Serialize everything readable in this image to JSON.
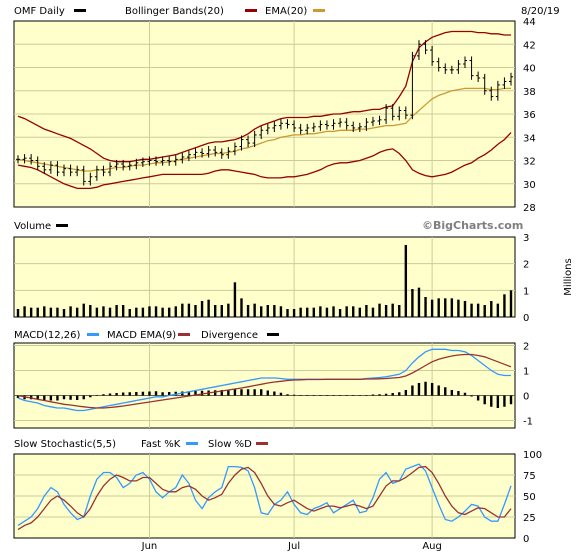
{
  "chart_data": {
    "type": "stock",
    "ticker_label": "OMF Daily",
    "date_label": "8/20/19",
    "watermark": "©BigCharts.com",
    "x_labels": [
      "Jun",
      "Jul",
      "Aug"
    ],
    "colors": {
      "bg": "#ffffcc",
      "grid": "#cccc99",
      "price": "#000000",
      "bollinger": "#990000",
      "ema": "#cc9933",
      "macd": "#3399ff",
      "macd_ema": "#993333",
      "fast_k": "#3399ff",
      "slow_d": "#993333"
    },
    "price_panel": {
      "legend": [
        "OMF Daily",
        "Bollinger Bands(20)",
        "EMA(20)"
      ],
      "ylim": [
        28,
        44
      ],
      "yticks": [
        28,
        30,
        32,
        34,
        36,
        38,
        40,
        42,
        44
      ],
      "close": [
        32.1,
        32.2,
        32.0,
        31.5,
        31.2,
        31.6,
        31.0,
        31.3,
        31.0,
        31.2,
        30.2,
        30.6,
        31.2,
        31.0,
        31.5,
        31.7,
        31.5,
        31.6,
        31.8,
        31.9,
        32.0,
        31.9,
        32.0,
        31.9,
        32.1,
        32.3,
        32.5,
        32.7,
        32.6,
        32.9,
        32.7,
        32.5,
        32.8,
        33.2,
        33.8,
        33.5,
        34.2,
        34.6,
        34.8,
        35.0,
        35.2,
        35.1,
        34.8,
        34.6,
        34.8,
        34.9,
        35.1,
        35.0,
        35.2,
        35.3,
        35.0,
        34.8,
        34.9,
        35.3,
        35.4,
        35.5,
        36.5,
        35.8,
        36.3,
        35.9,
        41.0,
        42.0,
        41.5,
        40.5,
        40.0,
        39.8,
        39.8,
        40.3,
        40.6,
        39.3,
        39.1,
        38.0,
        37.5,
        38.5,
        38.8,
        39.2
      ],
      "ema": [
        32.1,
        32.0,
        31.9,
        31.8,
        31.7,
        31.6,
        31.5,
        31.4,
        31.3,
        31.2,
        31.1,
        31.1,
        31.2,
        31.2,
        31.3,
        31.4,
        31.4,
        31.5,
        31.6,
        31.6,
        31.7,
        31.8,
        31.8,
        31.9,
        32.0,
        32.1,
        32.2,
        32.3,
        32.4,
        32.5,
        32.6,
        32.6,
        32.7,
        32.8,
        33.0,
        33.1,
        33.3,
        33.5,
        33.7,
        33.8,
        34.0,
        34.1,
        34.2,
        34.2,
        34.3,
        34.3,
        34.4,
        34.5,
        34.5,
        34.6,
        34.6,
        34.6,
        34.7,
        34.7,
        34.8,
        34.9,
        35.0,
        35.0,
        35.1,
        35.2,
        35.8,
        36.3,
        36.8,
        37.3,
        37.6,
        37.8,
        38.0,
        38.1,
        38.2,
        38.2,
        38.2,
        38.2,
        38.1,
        38.1,
        38.2,
        38.2
      ],
      "bb_upper": [
        35.8,
        35.6,
        35.3,
        35.0,
        34.7,
        34.5,
        34.3,
        34.1,
        33.9,
        33.6,
        33.3,
        33.0,
        32.6,
        32.2,
        32.0,
        31.9,
        31.9,
        31.9,
        32.0,
        32.1,
        32.1,
        32.2,
        32.3,
        32.4,
        32.5,
        32.7,
        32.9,
        33.1,
        33.3,
        33.5,
        33.6,
        33.6,
        33.7,
        33.8,
        34.0,
        34.3,
        34.7,
        35.0,
        35.2,
        35.4,
        35.6,
        35.7,
        35.7,
        35.7,
        35.7,
        35.8,
        35.8,
        35.9,
        36.0,
        36.0,
        36.1,
        36.2,
        36.2,
        36.3,
        36.4,
        36.4,
        36.6,
        36.7,
        37.5,
        38.4,
        40.5,
        41.7,
        42.2,
        42.6,
        42.8,
        43.0,
        43.1,
        43.1,
        43.1,
        43.1,
        43.0,
        43.0,
        42.9,
        42.9,
        42.8,
        42.8
      ],
      "bb_lower": [
        31.6,
        31.5,
        31.4,
        31.2,
        30.9,
        30.6,
        30.3,
        30.0,
        29.8,
        29.6,
        29.6,
        29.6,
        29.7,
        29.9,
        30.0,
        30.1,
        30.2,
        30.3,
        30.4,
        30.5,
        30.6,
        30.7,
        30.8,
        30.8,
        30.8,
        30.8,
        30.8,
        30.8,
        30.8,
        30.9,
        31.1,
        31.2,
        31.2,
        31.1,
        31.0,
        30.9,
        30.8,
        30.6,
        30.5,
        30.5,
        30.5,
        30.6,
        30.6,
        30.7,
        30.8,
        31.0,
        31.2,
        31.5,
        31.7,
        31.8,
        31.8,
        31.9,
        32.0,
        32.2,
        32.4,
        32.7,
        32.9,
        33.0,
        32.6,
        32.0,
        31.2,
        30.9,
        30.7,
        30.6,
        30.7,
        30.8,
        31.0,
        31.3,
        31.6,
        31.8,
        32.2,
        32.5,
        32.9,
        33.4,
        33.8,
        34.4
      ]
    },
    "volume_panel": {
      "legend": [
        "Volume"
      ],
      "units": "Millions",
      "ylim": [
        0,
        3
      ],
      "yticks": [
        0,
        1,
        2,
        3
      ],
      "values": [
        0.3,
        0.4,
        0.35,
        0.35,
        0.4,
        0.35,
        0.35,
        0.3,
        0.4,
        0.35,
        0.5,
        0.45,
        0.35,
        0.4,
        0.35,
        0.45,
        0.45,
        0.3,
        0.35,
        0.35,
        0.4,
        0.4,
        0.35,
        0.35,
        0.4,
        0.5,
        0.5,
        0.45,
        0.6,
        0.65,
        0.45,
        0.45,
        0.5,
        1.3,
        0.7,
        0.45,
        0.5,
        0.4,
        0.45,
        0.45,
        0.4,
        0.3,
        0.3,
        0.35,
        0.35,
        0.35,
        0.4,
        0.35,
        0.4,
        0.3,
        0.4,
        0.4,
        0.35,
        0.45,
        0.35,
        0.5,
        0.45,
        0.5,
        0.45,
        2.7,
        1.05,
        1.1,
        0.75,
        0.65,
        0.7,
        0.7,
        0.7,
        0.65,
        0.6,
        0.5,
        0.5,
        0.45,
        0.6,
        0.5,
        0.85,
        1.0
      ]
    },
    "macd_panel": {
      "legend": [
        "MACD(12,26)",
        "MACD EMA(9)",
        "Divergence"
      ],
      "ylim": [
        -1.3,
        2.1
      ],
      "yticks": [
        -1,
        0,
        1,
        2
      ],
      "macd": [
        -0.1,
        -0.2,
        -0.25,
        -0.3,
        -0.4,
        -0.45,
        -0.5,
        -0.5,
        -0.55,
        -0.6,
        -0.6,
        -0.55,
        -0.5,
        -0.45,
        -0.4,
        -0.35,
        -0.3,
        -0.25,
        -0.2,
        -0.15,
        -0.1,
        -0.05,
        -0.05,
        0.0,
        0.05,
        0.1,
        0.15,
        0.2,
        0.25,
        0.3,
        0.35,
        0.4,
        0.45,
        0.5,
        0.55,
        0.6,
        0.65,
        0.7,
        0.7,
        0.7,
        0.68,
        0.65,
        0.65,
        0.65,
        0.65,
        0.65,
        0.65,
        0.65,
        0.65,
        0.65,
        0.65,
        0.65,
        0.65,
        0.68,
        0.7,
        0.72,
        0.75,
        0.8,
        0.85,
        1.0,
        1.3,
        1.55,
        1.75,
        1.85,
        1.85,
        1.85,
        1.8,
        1.8,
        1.75,
        1.6,
        1.4,
        1.2,
        1.0,
        0.85,
        0.8,
        0.8
      ],
      "signal": [
        0.0,
        -0.05,
        -0.1,
        -0.15,
        -0.2,
        -0.25,
        -0.3,
        -0.35,
        -0.38,
        -0.42,
        -0.45,
        -0.48,
        -0.5,
        -0.5,
        -0.48,
        -0.45,
        -0.42,
        -0.38,
        -0.34,
        -0.3,
        -0.26,
        -0.22,
        -0.18,
        -0.14,
        -0.1,
        -0.06,
        -0.02,
        0.02,
        0.06,
        0.1,
        0.14,
        0.18,
        0.22,
        0.26,
        0.3,
        0.35,
        0.4,
        0.45,
        0.5,
        0.54,
        0.57,
        0.6,
        0.62,
        0.63,
        0.64,
        0.64,
        0.64,
        0.65,
        0.65,
        0.65,
        0.65,
        0.65,
        0.65,
        0.66,
        0.66,
        0.67,
        0.68,
        0.7,
        0.72,
        0.78,
        0.9,
        1.05,
        1.2,
        1.35,
        1.45,
        1.52,
        1.58,
        1.62,
        1.64,
        1.64,
        1.6,
        1.55,
        1.45,
        1.35,
        1.25,
        1.15
      ]
    },
    "stoch_panel": {
      "legend": [
        "Slow Stochastic(5,5)",
        "Fast %K",
        "Slow %D"
      ],
      "ylim": [
        0,
        100
      ],
      "yticks": [
        0,
        25,
        50,
        75,
        100
      ],
      "fast_k": [
        15,
        20,
        25,
        35,
        50,
        60,
        55,
        40,
        30,
        22,
        25,
        50,
        70,
        78,
        78,
        72,
        60,
        65,
        75,
        78,
        70,
        55,
        48,
        55,
        60,
        75,
        65,
        45,
        35,
        48,
        55,
        60,
        85,
        85,
        84,
        80,
        60,
        30,
        28,
        40,
        45,
        55,
        40,
        30,
        28,
        35,
        38,
        42,
        30,
        35,
        40,
        45,
        30,
        32,
        48,
        70,
        78,
        65,
        68,
        82,
        85,
        88,
        80,
        60,
        40,
        22,
        20,
        25,
        32,
        40,
        38,
        25,
        20,
        20,
        40,
        62
      ],
      "slow_d": [
        10,
        15,
        18,
        25,
        35,
        45,
        50,
        45,
        38,
        30,
        25,
        35,
        50,
        62,
        70,
        75,
        72,
        68,
        68,
        72,
        72,
        65,
        58,
        55,
        55,
        60,
        62,
        58,
        50,
        45,
        48,
        52,
        65,
        75,
        82,
        84,
        78,
        65,
        50,
        40,
        38,
        42,
        45,
        40,
        35,
        32,
        35,
        38,
        38,
        36,
        38,
        40,
        38,
        35,
        38,
        50,
        62,
        68,
        68,
        72,
        78,
        84,
        85,
        78,
        65,
        50,
        38,
        30,
        28,
        32,
        36,
        35,
        30,
        25,
        25,
        35
      ]
    }
  }
}
